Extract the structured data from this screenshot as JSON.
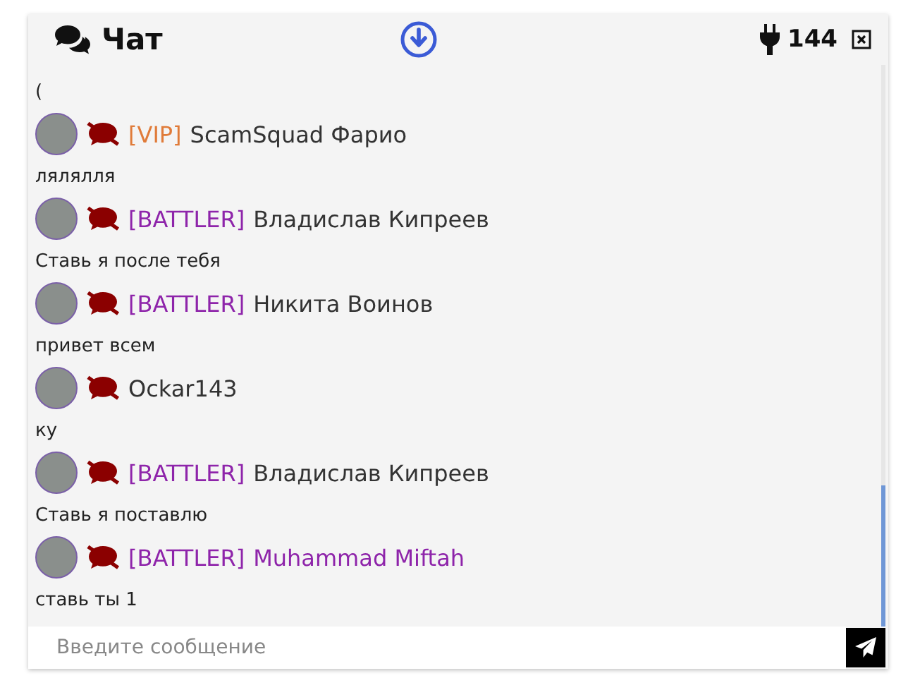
{
  "header": {
    "title": "Чат",
    "online_count": "144"
  },
  "messages": [
    {
      "kind": "text_only",
      "text": "("
    },
    {
      "kind": "message",
      "muted": true,
      "tag": {
        "label": "[VIP]",
        "color": "#e07b39"
      },
      "name": "ScamSquad Фарио",
      "highlighted": false,
      "text": "лялялля"
    },
    {
      "kind": "message",
      "muted": true,
      "tag": {
        "label": "[BATTLER]",
        "color": "#8e24aa"
      },
      "name": "Владислав Кипреев",
      "highlighted": false,
      "text": "Ставь я после тебя"
    },
    {
      "kind": "message",
      "muted": true,
      "tag": {
        "label": "[BATTLER]",
        "color": "#8e24aa"
      },
      "name": "Никита Воинов",
      "highlighted": false,
      "text": "привет всем"
    },
    {
      "kind": "message",
      "muted": true,
      "name": "Ockar143",
      "highlighted": false,
      "text": "ку"
    },
    {
      "kind": "message",
      "muted": true,
      "tag": {
        "label": "[BATTLER]",
        "color": "#8e24aa"
      },
      "name": "Владислав Кипреев",
      "highlighted": false,
      "text": "Ставь я поставлю"
    },
    {
      "kind": "message",
      "muted": true,
      "tag": {
        "label": "[BATTLER]",
        "color": "#8e24aa"
      },
      "name": "Muhammad Miftah",
      "highlighted": true,
      "text": "ставь ты 1"
    }
  ],
  "input": {
    "placeholder": "Введите сообщение"
  }
}
